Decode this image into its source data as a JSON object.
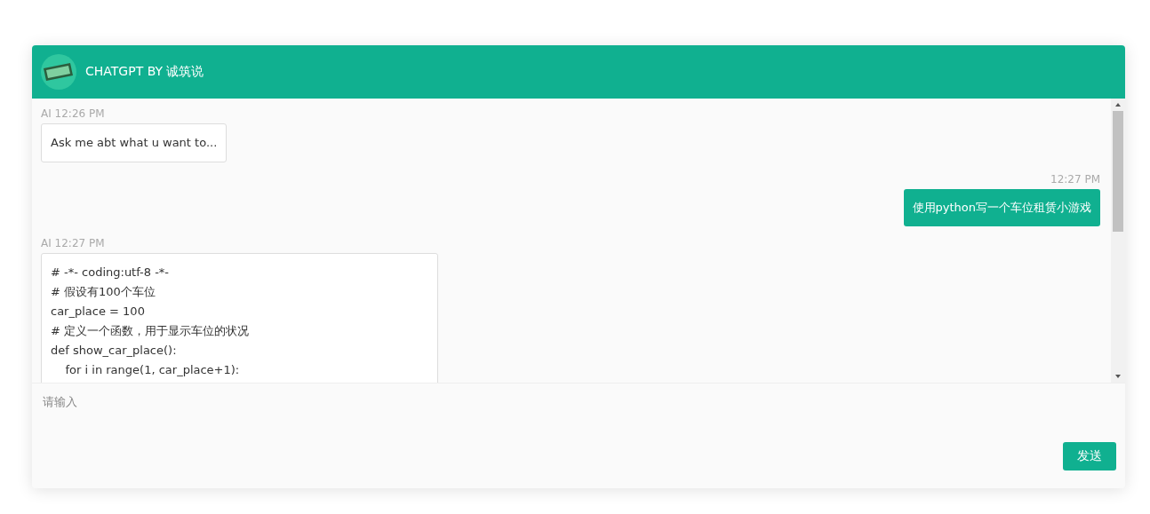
{
  "header": {
    "title": "CHATGPT BY 诚筑说"
  },
  "messages": [
    {
      "kind": "ai",
      "meta": "AI 12:26 PM",
      "lines": [
        "Ask me abt what u want to..."
      ]
    },
    {
      "kind": "user",
      "meta": "12:27 PM",
      "lines": [
        "使用python写一个车位租赁小游戏"
      ]
    },
    {
      "kind": "ai",
      "meta": "AI 12:27 PM",
      "lines": [
        "# -*- coding:utf-8 -*-",
        "# 假设有100个车位",
        "car_place = 100",
        "# 定义一个函数，用于显示车位的状况",
        "def show_car_place():",
        "    for i in range(1, car_place+1):"
      ]
    }
  ],
  "composer": {
    "placeholder": "请输入",
    "send_label": "发送"
  }
}
